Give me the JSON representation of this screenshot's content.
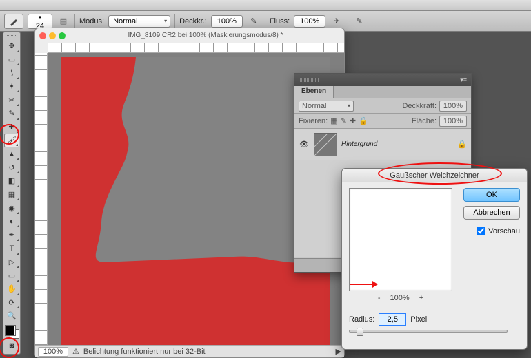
{
  "options_bar": {
    "modus_label": "Modus:",
    "modus_value": "Normal",
    "deckkr_label": "Deckkr.:",
    "deckkr_value": "100%",
    "fluss_label": "Fluss:",
    "fluss_value": "100%",
    "brush_size": "24"
  },
  "document": {
    "title": "IMG_8109.CR2 bei 100% (Maskierungsmodus/8) *",
    "zoom": "100%",
    "status_icon_label": "⚠",
    "status_text": "Belichtung funktioniert nur bei 32-Bit"
  },
  "layers_panel": {
    "tab": "Ebenen",
    "blend_mode": "Normal",
    "deckkraft_label": "Deckkraft:",
    "deckkraft_value": "100%",
    "fixieren_label": "Fixieren:",
    "flaeche_label": "Fläche:",
    "flaeche_value": "100%",
    "layer_name": "Hintergrund"
  },
  "dialog": {
    "title": "Gaußscher Weichzeichner",
    "ok": "OK",
    "cancel": "Abbrechen",
    "preview_label": "Vorschau",
    "preview_checked": true,
    "zoom_value": "100%",
    "radius_label": "Radius:",
    "radius_value": "2,5",
    "radius_unit": "Pixel",
    "zoom_minus": "-",
    "zoom_plus": "+"
  },
  "tool_names": [
    "move-tool",
    "marquee-tool",
    "lasso-tool",
    "quick-select-tool",
    "crop-tool",
    "eyedropper-tool",
    "healing-tool",
    "brush-tool",
    "stamp-tool",
    "history-brush-tool",
    "eraser-tool",
    "gradient-tool",
    "blur-tool",
    "dodge-tool",
    "pen-tool",
    "type-tool",
    "path-select-tool",
    "shape-tool",
    "hand-tool",
    "rotate-view-tool",
    "zoom-tool"
  ]
}
